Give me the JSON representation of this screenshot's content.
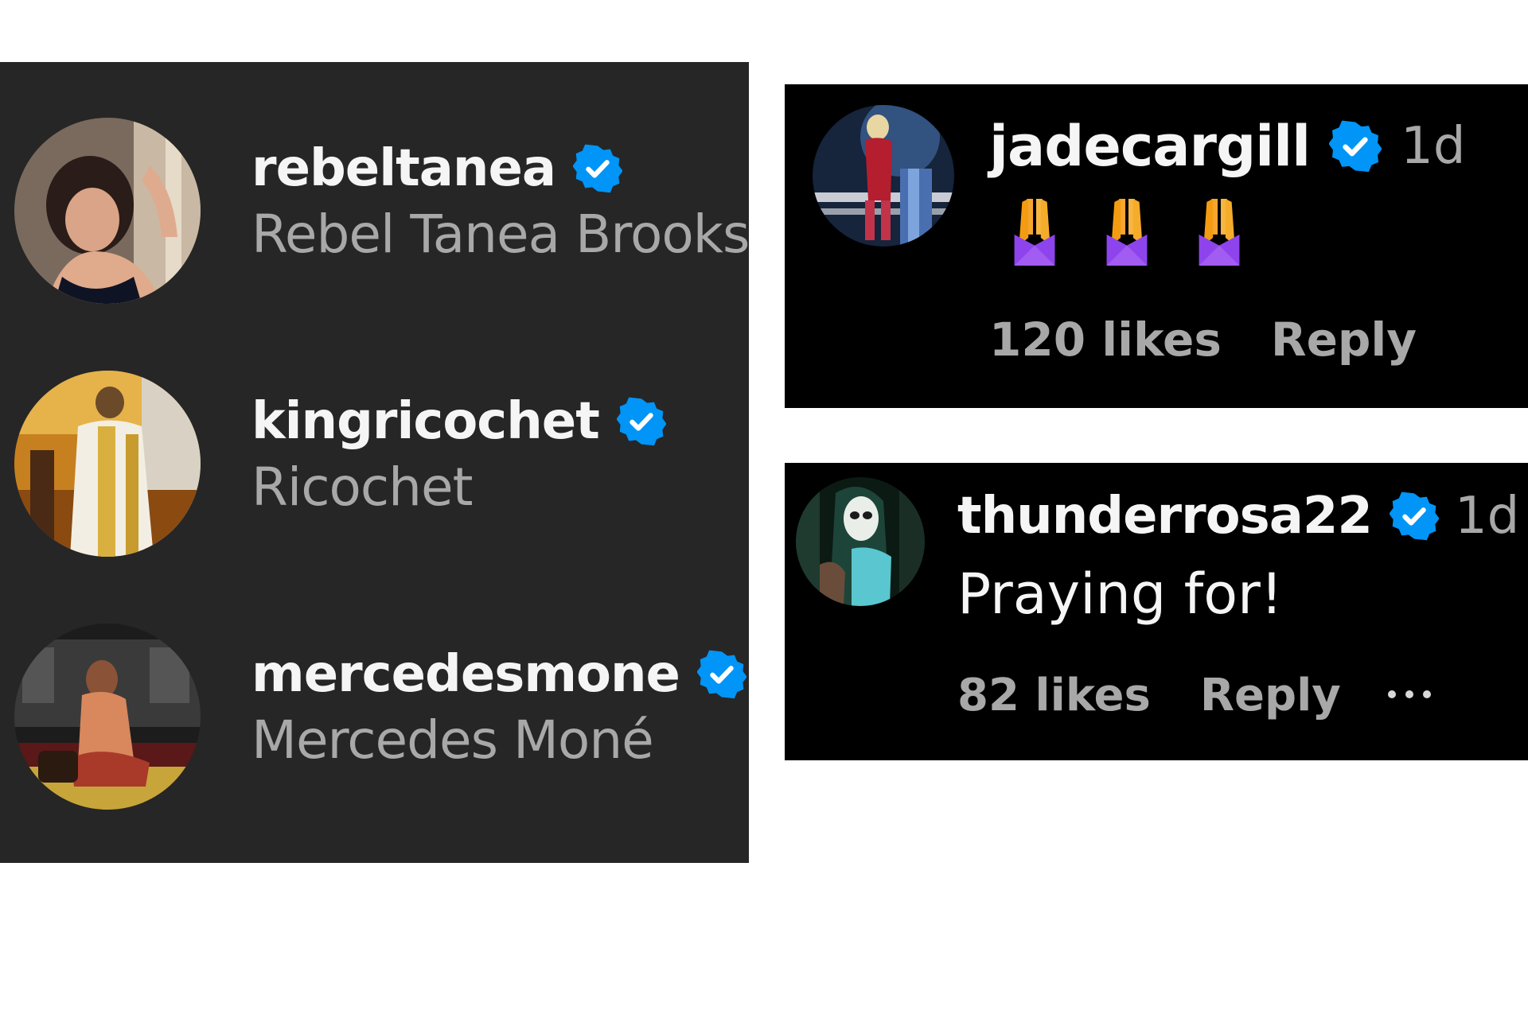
{
  "users": [
    {
      "handle": "rebeltanea",
      "name": "Rebel Tanea Brooks",
      "verified": true
    },
    {
      "handle": "kingricochet",
      "name": "Ricochet",
      "verified": true
    },
    {
      "handle": "mercedesmone",
      "name": "Mercedes Moné",
      "verified": true
    }
  ],
  "comments": [
    {
      "handle": "jadecargill",
      "time": "1d",
      "text": "🙏🙏🙏",
      "emoji": "praying-hands",
      "emoji_count": 3,
      "likes": "120 likes",
      "reply": "Reply",
      "verified": true
    },
    {
      "handle": "thunderrosa22",
      "time": "1d",
      "text": "Praying for!",
      "likes": "82 likes",
      "reply": "Reply",
      "verified": true
    }
  ],
  "colors": {
    "list_bg": "#262626",
    "card_bg": "#000000",
    "verified_blue": "#0095f6",
    "primary_text": "#f5f5f5",
    "secondary_text": "#a8a8a8"
  }
}
